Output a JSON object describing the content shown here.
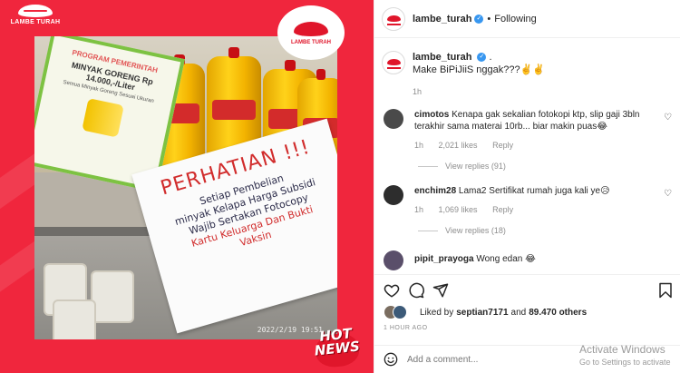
{
  "post_image": {
    "brand_logo_text": "LAMBE TURAH",
    "green_sign": {
      "title": "PROGRAM PEMERINTAH",
      "line": "MINYAK GORENG Rp 14.000,-/Liter",
      "small": "Semua Minyak Goreng Sesuai Ukuran"
    },
    "notice": {
      "title": "PERHATIAN !!!",
      "lines": [
        "Setiap Pembelian",
        "minyak Kelapa Harga Subsidi",
        "Wajib Sertakan Fotocopy"
      ],
      "red_lines": [
        "Kartu Keluarga Dan Bukti",
        "Vaksin"
      ]
    },
    "photo_date": "2022/2/19 19:51",
    "hot_news": [
      "HOT",
      "NEWS"
    ]
  },
  "header": {
    "username": "lambe_turah",
    "verified": true,
    "separator": "•",
    "follow_status": "Following"
  },
  "caption": {
    "username": "lambe_turah",
    "suffix": ".",
    "text": "Make BiPiJiiS nggak???✌️✌️",
    "time": "1h"
  },
  "comments": [
    {
      "username": "cimotos",
      "text": "Kenapa gak sekalian fotokopi ktp, slip gaji 3bln terakhir sama materai 10rb... biar makin puas😂",
      "time": "1h",
      "likes": "2,021 likes",
      "reply": "Reply",
      "view_replies": "View replies (91)",
      "avatar_color": "#4a4a4a"
    },
    {
      "username": "enchim28",
      "text": "Lama2 Sertifikat rumah juga kali ye😥",
      "time": "1h",
      "likes": "1,069 likes",
      "reply": "Reply",
      "view_replies": "View replies (18)",
      "avatar_color": "#2d2d2d"
    },
    {
      "username": "pipit_prayoga",
      "text": "Wong edan 😂",
      "avatar_color": "#5a4f6a"
    }
  ],
  "likes": {
    "prefix": "Liked by",
    "user": "septian7171",
    "middle": "and",
    "count": "89.470 others"
  },
  "ago": "1 HOUR AGO",
  "add_comment": {
    "placeholder": "Add a comment..."
  },
  "watermark": {
    "title": "Activate Windows",
    "subtitle": "Go to Settings to activate"
  },
  "icons": [
    "heart-icon",
    "comment-icon",
    "share-icon",
    "bookmark-icon",
    "smiley-icon",
    "verified-icon"
  ],
  "colors": {
    "accent": "#f0263d",
    "verified": "#3897f0",
    "muted": "#8e8e8e"
  }
}
